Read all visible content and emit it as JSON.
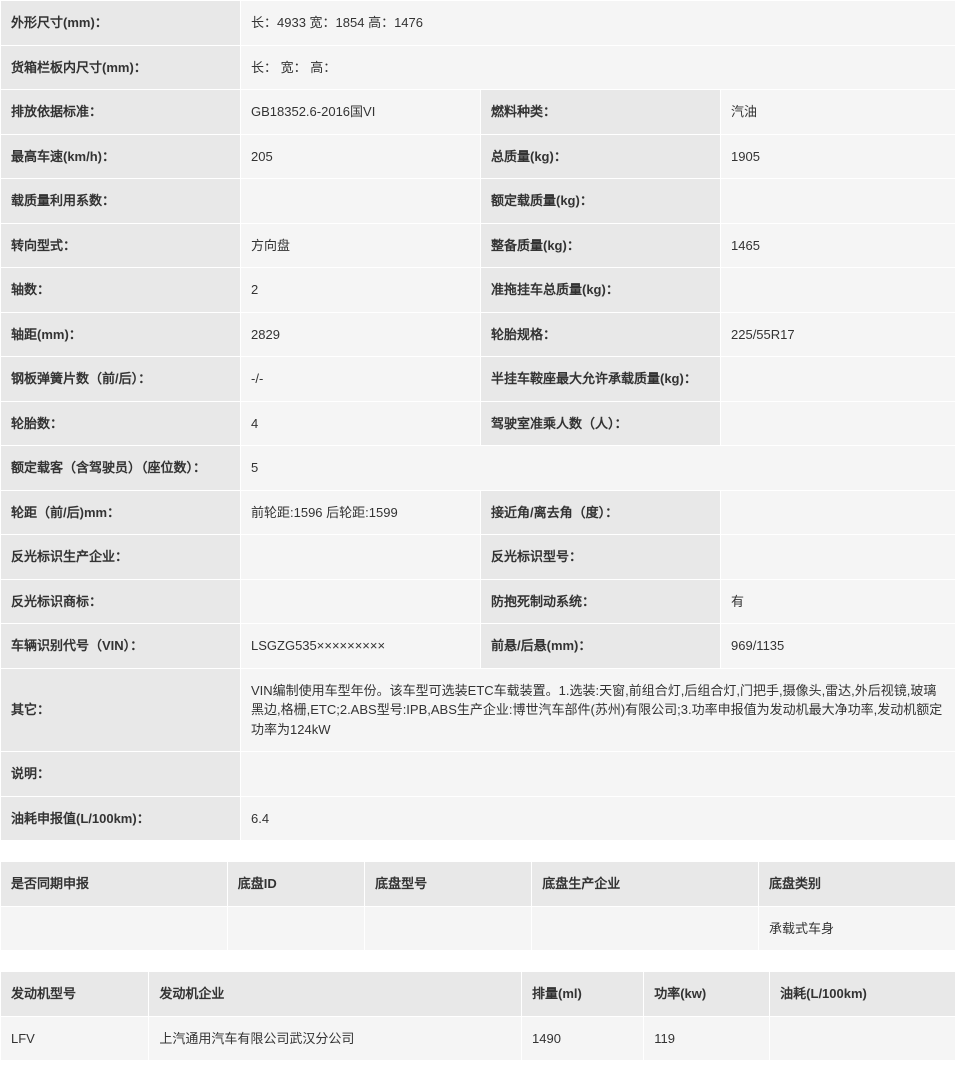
{
  "specs": {
    "dimensions_label": "外形尺寸(mm)：",
    "dimensions_value": "长：4933 宽：1854 高：1476",
    "cargo_label": "货箱栏板内尺寸(mm)：",
    "cargo_value": "长： 宽： 高：",
    "emission_label": "排放依据标准：",
    "emission_value": "GB18352.6-2016国VI",
    "fuel_label": "燃料种类：",
    "fuel_value": "汽油",
    "maxspeed_label": "最高车速(km/h)：",
    "maxspeed_value": "205",
    "totalmass_label": "总质量(kg)：",
    "totalmass_value": "1905",
    "loadfactor_label": "载质量利用系数：",
    "loadfactor_value": "",
    "ratedload_label": "额定载质量(kg)：",
    "ratedload_value": "",
    "steering_label": "转向型式：",
    "steering_value": "方向盘",
    "curbmass_label": "整备质量(kg)：",
    "curbmass_value": "1465",
    "axles_label": "轴数：",
    "axles_value": "2",
    "trailermass_label": "准拖挂车总质量(kg)：",
    "trailermass_value": "",
    "wheelbase_label": "轴距(mm)：",
    "wheelbase_value": "2829",
    "tirespec_label": "轮胎规格：",
    "tirespec_value": "225/55R17",
    "leafspring_label": "钢板弹簧片数（前/后）：",
    "leafspring_value": "-/-",
    "semitrailer_label": "半挂车鞍座最大允许承载质量(kg)：",
    "semitrailer_value": "",
    "tirecount_label": "轮胎数：",
    "tirecount_value": "4",
    "cabseats_label": "驾驶室准乘人数（人）：",
    "cabseats_value": "",
    "ratedpass_label": "额定载客（含驾驶员）（座位数）：",
    "ratedpass_value": "5",
    "track_label": "轮距（前/后)mm：",
    "track_value": "前轮距:1596 后轮距:1599",
    "angle_label": "接近角/离去角（度）：",
    "angle_value": "",
    "reflectmfr_label": "反光标识生产企业：",
    "reflectmfr_value": "",
    "reflectmodel_label": "反光标识型号：",
    "reflectmodel_value": "",
    "reflectbrand_label": "反光标识商标：",
    "reflectbrand_value": "",
    "abs_label": "防抱死制动系统：",
    "abs_value": "有",
    "vin_label": "车辆识别代号（VIN）：",
    "vin_value": "LSGZG535×××××××××",
    "overhang_label": "前悬/后悬(mm)：",
    "overhang_value": "969/1135",
    "other_label": "其它：",
    "other_value": "VIN编制使用车型年份。该车型可选装ETC车载装置。1.选装:天窗,前组合灯,后组合灯,门把手,摄像头,雷达,外后视镜,玻璃黑边,格栅,ETC;2.ABS型号:IPB,ABS生产企业:博世汽车部件(苏州)有限公司;3.功率申报值为发动机最大净功率,发动机额定功率为124kW",
    "note_label": "说明：",
    "note_value": "",
    "fuelcons_label": "油耗申报值(L/100km)：",
    "fuelcons_value": "6.4"
  },
  "chassis": {
    "headers": {
      "same_period": "是否同期申报",
      "chassis_id": "底盘ID",
      "chassis_model": "底盘型号",
      "chassis_mfr": "底盘生产企业",
      "chassis_type": "底盘类别"
    },
    "row": {
      "same_period": "",
      "chassis_id": "",
      "chassis_model": "",
      "chassis_mfr": "",
      "chassis_type": "承载式车身"
    }
  },
  "engine": {
    "headers": {
      "model": "发动机型号",
      "mfr": "发动机企业",
      "displacement": "排量(ml)",
      "power": "功率(kw)",
      "fuel": "油耗(L/100km)"
    },
    "row": {
      "model": "LFV",
      "mfr": "上汽通用汽车有限公司武汉分公司",
      "displacement": "1490",
      "power": "119",
      "fuel": ""
    }
  }
}
